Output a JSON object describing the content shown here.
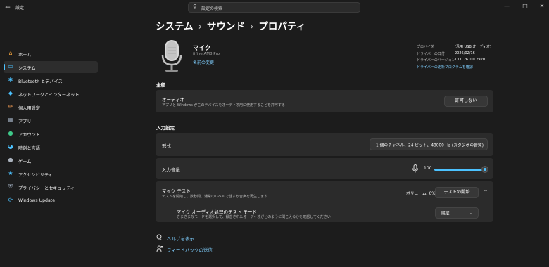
{
  "window": {
    "title": "設定",
    "search_placeholder": "設定の検索",
    "controls": [
      "minimize-icon",
      "maximize-icon",
      "close-icon"
    ]
  },
  "sidebar": {
    "items": [
      {
        "label": "ホーム",
        "icon": "home-icon",
        "color": "#f3a33c"
      },
      {
        "label": "システム",
        "icon": "system-icon",
        "color": "#4cc2ff",
        "selected": true
      },
      {
        "label": "Bluetooth とデバイス",
        "icon": "bluetooth-icon",
        "color": "#4cc2ff"
      },
      {
        "label": "ネットワークとインターネット",
        "icon": "network-icon",
        "color": "#4cc2ff"
      },
      {
        "label": "個人用設定",
        "icon": "brush-icon",
        "color": "#f09a54"
      },
      {
        "label": "アプリ",
        "icon": "apps-icon",
        "color": "#9aa7b8"
      },
      {
        "label": "アカウント",
        "icon": "account-icon",
        "color": "#3fc98a"
      },
      {
        "label": "時刻と言語",
        "icon": "globe-clock-icon",
        "color": "#4cc2ff"
      },
      {
        "label": "ゲーム",
        "icon": "game-icon",
        "color": "#aab2bd"
      },
      {
        "label": "アクセシビリティ",
        "icon": "accessibility-icon",
        "color": "#4cc2ff"
      },
      {
        "label": "プライバシーとセキュリティ",
        "icon": "shield-icon",
        "color": "#9aa7b8"
      },
      {
        "label": "Windows Update",
        "icon": "update-icon",
        "color": "#4cc2ff"
      }
    ]
  },
  "breadcrumb": [
    "システム",
    "サウンド",
    "プロパティ"
  ],
  "device": {
    "name": "マイク",
    "model": "fifine AM8 Pro",
    "rename_link": "名前の変更",
    "props": [
      {
        "label": "プロバイダー",
        "value": "(汎用 USB オーディオ)"
      },
      {
        "label": "ドライバーの日付",
        "value": "2026/02/16"
      },
      {
        "label": "ドライバーのバージョン",
        "value": "10.0.26100.7920"
      }
    ],
    "update_link": "ドライバーの更新プログラムを確認"
  },
  "general": {
    "heading": "全般",
    "audio_title": "オーディオ",
    "audio_desc": "アプリと Windows がこのデバイスをオーディオ用に使用することを許可する",
    "deny_button": "許可しない"
  },
  "input": {
    "heading": "入力設定",
    "format_label": "形式",
    "format_value": "1 個のチャネル、24 ビット、48000 Hz (スタジオの音質)",
    "volume_label": "入力音量",
    "volume_value": "100",
    "volume_level": 1.0
  },
  "mic_test": {
    "title": "マイク テスト",
    "desc": "テストを開始し、数秒間、通常のレベルで話すか音声を再生します",
    "volume_text": "ボリューム: 0%",
    "start_button": "テストの開始",
    "mode_title": "マイク オーディオ処理のテスト モード",
    "mode_desc": "さまざまなモードを選択して、録音されたオーディオがどのように聞こえるかを確認してください",
    "mode_value": "既定"
  },
  "footer": {
    "help_link": "ヘルプを表示",
    "feedback_link": "フィードバックの送信"
  },
  "colors": {
    "accent": "#4cc2ff",
    "background": "#1c1c1c",
    "card": "#2b2b2b"
  }
}
